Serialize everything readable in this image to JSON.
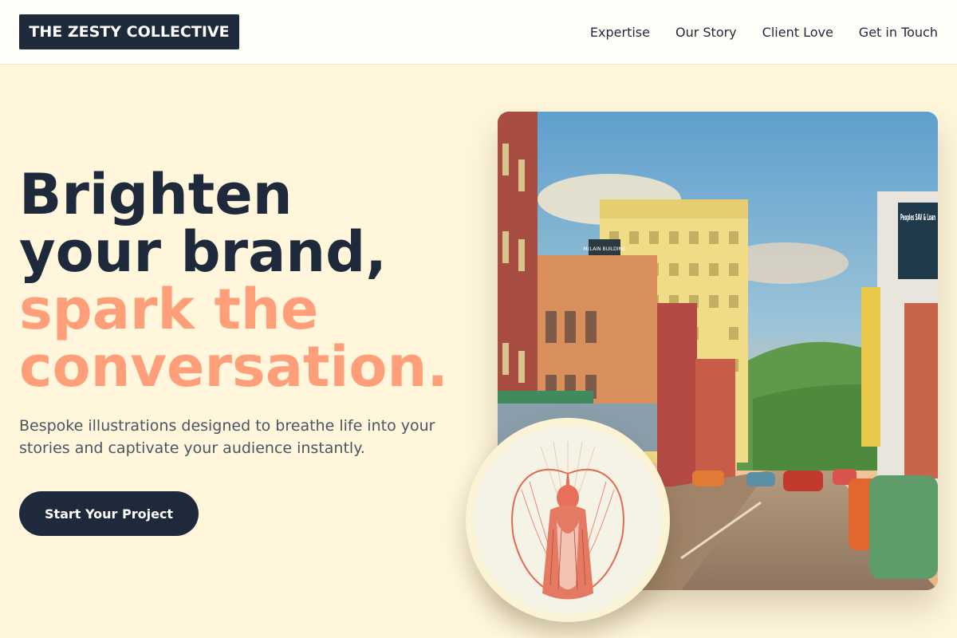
{
  "header": {
    "logo": "THE ZESTY COLLECTIVE",
    "nav": [
      {
        "label": "Expertise"
      },
      {
        "label": "Our Story"
      },
      {
        "label": "Client Love"
      },
      {
        "label": "Get in Touch"
      }
    ]
  },
  "hero": {
    "title_line1": "Brighten",
    "title_line2": "your brand,",
    "title_line3": "spark the",
    "title_line4": "conversation.",
    "subtitle": "Bespoke illustrations designed to breathe life into your stories and captivate your audience instantly.",
    "cta_label": "Start Your Project"
  },
  "images": {
    "main": {
      "sign_bank": "Peoples SAV & Loan",
      "sign_building": "McLAIN BUILDING"
    }
  },
  "colors": {
    "primary": "#1e293b",
    "accent": "#ff9f7a",
    "background": "#fff6dc"
  }
}
